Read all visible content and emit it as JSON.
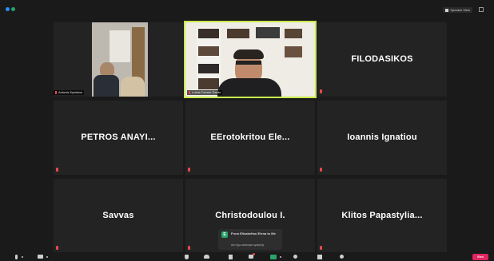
{
  "window": {
    "speaker_view_label": "Speaker View"
  },
  "participants": [
    {
      "name": "Antonis Kyriakou",
      "type": "video",
      "muted": true
    },
    {
      "name": "Lukas Farmer Santo",
      "type": "video",
      "muted": true,
      "active_speaker": true
    },
    {
      "name": "FILODASIKOS",
      "type": "name",
      "muted": true
    },
    {
      "name": "PETROS ANAYI...",
      "type": "name",
      "muted": true
    },
    {
      "name": "EErotokritou Ele...",
      "type": "name",
      "muted": true
    },
    {
      "name": "Ioannis Ignatiou",
      "type": "name",
      "muted": true
    },
    {
      "name": "Savvas",
      "type": "name",
      "muted": true
    },
    {
      "name": "Christodoulou I.",
      "type": "name",
      "muted": true
    },
    {
      "name": "Klitos Papastylia...",
      "type": "name",
      "muted": true
    }
  ],
  "chat_toast": {
    "avatar_letter": "E",
    "from": "From Elisabeltou Elena to Me",
    "message": "Δεν έχω κάλεσμα ομιλητής"
  },
  "toolbar": {
    "end_label": "End"
  },
  "colors": {
    "active_border": "#c8e84a",
    "muted_red": "#e5484d",
    "end_button": "#e0245e",
    "tile_bg": "#232323",
    "app_bg": "#1a1a1a"
  }
}
